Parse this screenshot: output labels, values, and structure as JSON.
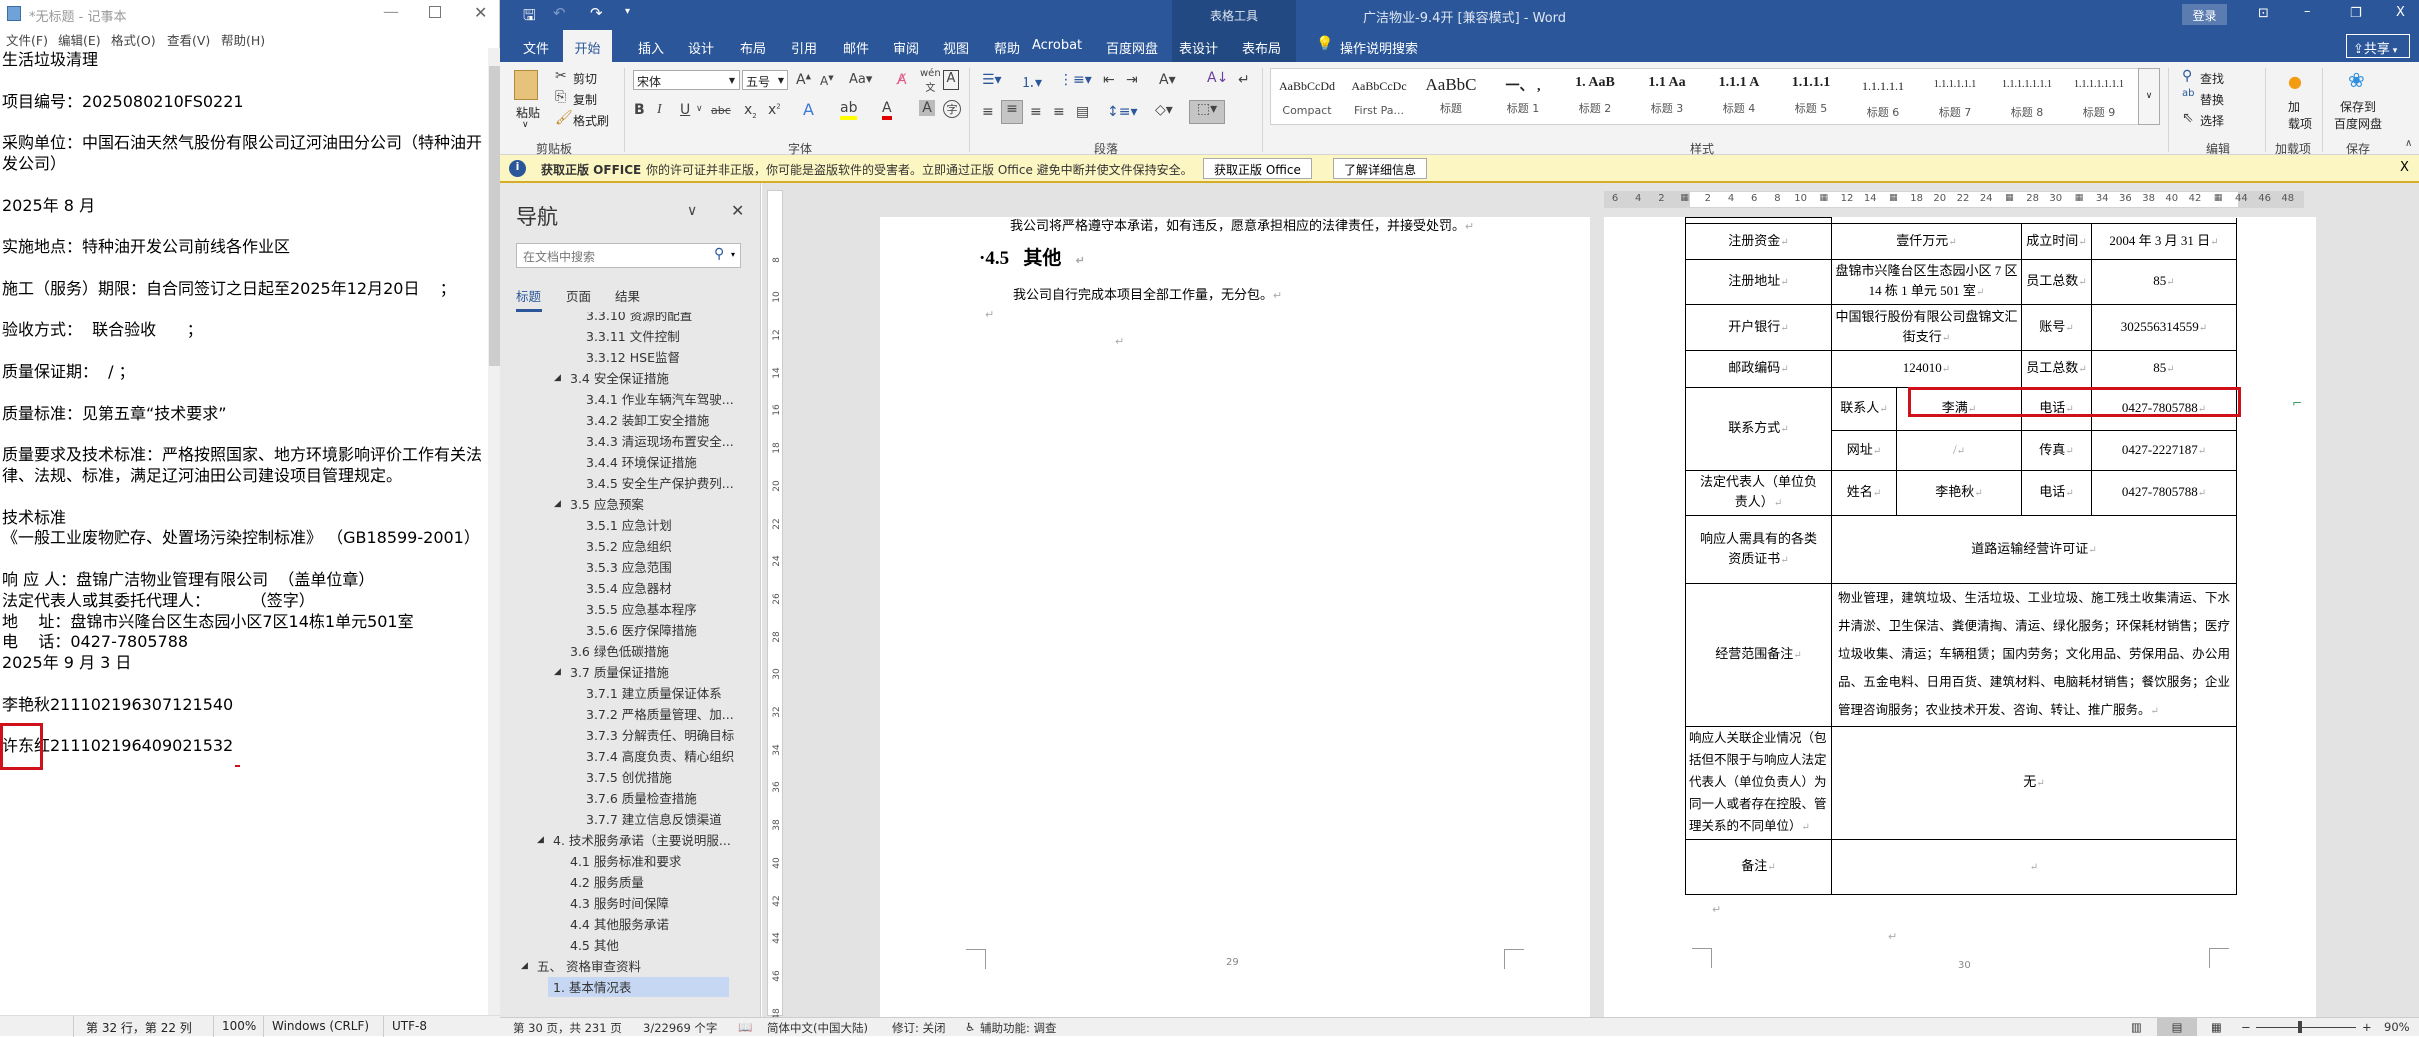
{
  "notepad": {
    "title": "*无标题 - 记事本",
    "menu": [
      "文件(F)",
      "编辑(E)",
      "格式(O)",
      "查看(V)",
      "帮助(H)"
    ],
    "text": "生活垃圾清理\n\n项目编号：2025080210FS0221\n\n采购单位：中国石油天然气股份有限公司辽河油田分公司（特种油开发公司）\n\n2025年 8 月\n\n实施地点：特种油开发公司前线各作业区\n\n施工（服务）期限：自合同签订之日起至2025年12月20日    ；\n\n验收方式：  联合验收      ；\n\n质量保证期：  / ；\n\n质量标准：见第五章“技术要求”\n\n质量要求及技术标准：严格按照国家、地方环境影响评价工作有关法律、法规、标准，满足辽河油田公司建设项目管理规定。\n\n技术标准\n《一般工业废物贮存、处置场污染控制标准》 （GB18599-2001）\n\n响 应 人：盘锦广洁物业管理有限公司  （盖单位章）\n法定代表人或其委托代理人：        （签字）\n地    址：盘锦市兴隆台区生态园小区7区14栋1单元501室\n电    话：0427-7805788\n2025年 9 月 3 日\n\n李艳秋211102196307121540\n\n许东红211102196409021532",
    "status": {
      "position": "第 32 行，第 22 列",
      "zoom": "100%",
      "line_ending": "Windows (CRLF)",
      "encoding": "UTF-8"
    }
  },
  "word": {
    "title": "广洁物业-9.4开 [兼容模式]  -  Word",
    "context_tab_group": "表格工具",
    "login": "登录",
    "share": "共享",
    "tabs": [
      "文件",
      "开始",
      "插入",
      "设计",
      "布局",
      "引用",
      "邮件",
      "审阅",
      "视图",
      "帮助",
      "Acrobat",
      "百度网盘",
      "表设计",
      "表布局"
    ],
    "tell_me": "操作说明搜索",
    "ribbon": {
      "clipboard": {
        "paste": "粘贴",
        "cut": "剪切",
        "copy": "复制",
        "format_painter": "格式刷",
        "label": "剪贴板"
      },
      "font": {
        "name": "宋体",
        "size": "五号",
        "label": "字体"
      },
      "paragraph": {
        "label": "段落"
      },
      "styles": {
        "label": "样式",
        "items": [
          {
            "preview": "AaBbCcDd",
            "name": "Compact"
          },
          {
            "preview": "AaBbCcDc",
            "name": "First Pa..."
          },
          {
            "preview": "AaBbC",
            "name": "标题"
          },
          {
            "preview": "一、 ,",
            "name": "标题 1"
          },
          {
            "preview": "1. AaB",
            "name": "标题 2"
          },
          {
            "preview": "1.1  Aa",
            "name": "标题 3"
          },
          {
            "preview": "1.1.1  A",
            "name": "标题 4"
          },
          {
            "preview": "1.1.1.1",
            "name": "标题 5"
          },
          {
            "preview": "1.1.1.1.1",
            "name": "标题 6"
          },
          {
            "preview": "1.1.1.1.1.1",
            "name": "标题 7"
          },
          {
            "preview": "1.1.1.1.1.1.1",
            "name": "标题 8"
          },
          {
            "preview": "1.1.1.1.1.1.1",
            "name": "标题 9"
          }
        ]
      },
      "editing": {
        "find": "查找",
        "replace": "替换",
        "select": "选择",
        "label": "编辑"
      },
      "addins": {
        "button_line1": "加",
        "button_line2": "载项",
        "label": "加载项"
      },
      "save": {
        "button_line1": "保存到",
        "button_line2": "百度网盘",
        "label": "保存"
      }
    },
    "message_bar": {
      "title": "获取正版 OFFICE",
      "text": "你的许可证并非正版，你可能是盗版软件的受害者。立即通过正版 Office 避免中断并使文件保持安全。",
      "btn_get": "获取正版 Office",
      "btn_learn": "了解详细信息"
    },
    "nav": {
      "title": "导航",
      "search_placeholder": "在文档中搜索",
      "tabs": [
        "标题",
        "页面",
        "结果"
      ],
      "items": [
        {
          "label": "3.3.10 资源的配置",
          "level": 3
        },
        {
          "label": "3.3.11 文件控制",
          "level": 3
        },
        {
          "label": "3.3.12 HSE监督",
          "level": 3
        },
        {
          "label": "3.4 安全保证措施",
          "level": 2,
          "expanded": true
        },
        {
          "label": "3.4.1 作业车辆汽车驾驶...",
          "level": 3
        },
        {
          "label": "3.4.2 装卸工安全措施",
          "level": 3
        },
        {
          "label": "3.4.3 清运现场布置安全...",
          "level": 3
        },
        {
          "label": "3.4.4 环境保证措施",
          "level": 3
        },
        {
          "label": "3.4.5 安全生产保护费列...",
          "level": 3
        },
        {
          "label": "3.5 应急预案",
          "level": 2,
          "expanded": true
        },
        {
          "label": "3.5.1 应急计划",
          "level": 3
        },
        {
          "label": "3.5.2 应急组织",
          "level": 3
        },
        {
          "label": "3.5.3 应急范围",
          "level": 3
        },
        {
          "label": "3.5.4 应急器材",
          "level": 3
        },
        {
          "label": "3.5.5 应急基本程序",
          "level": 3
        },
        {
          "label": "3.5.6 医疗保障措施",
          "level": 3
        },
        {
          "label": "3.6 绿色低碳措施",
          "level": 2
        },
        {
          "label": "3.7 质量保证措施",
          "level": 2,
          "expanded": true
        },
        {
          "label": "3.7.1 建立质量保证体系",
          "level": 3
        },
        {
          "label": "3.7.2 严格质量管理、加...",
          "level": 3
        },
        {
          "label": "3.7.3 分解责任、明确目标",
          "level": 3
        },
        {
          "label": "3.7.4 高度负责、精心组织",
          "level": 3
        },
        {
          "label": "3.7.5 创优措施",
          "level": 3
        },
        {
          "label": "3.7.6 质量检查措施",
          "level": 3
        },
        {
          "label": "3.7.7 建立信息反馈渠道",
          "level": 3
        },
        {
          "label": "4. 技术服务承诺（主要说明服...",
          "level": 1,
          "expanded": true
        },
        {
          "label": "4.1 服务标准和要求",
          "level": 2
        },
        {
          "label": "4.2 服务质量",
          "level": 2
        },
        {
          "label": "4.3 服务时间保障",
          "level": 2
        },
        {
          "label": "4.4 其他服务承诺",
          "level": 2
        },
        {
          "label": "4.5 其他",
          "level": 2
        },
        {
          "label": "五、 资格审查资料",
          "level": 0,
          "expanded": true
        },
        {
          "label": "1. 基本情况表",
          "level": 1,
          "selected": true
        }
      ]
    },
    "hruler_labels": [
      "6",
      "4",
      "2",
      "",
      "2",
      "4",
      "6",
      "8",
      "10",
      "",
      "12",
      "14",
      "",
      "18",
      "20",
      "22",
      "24",
      "",
      "28",
      "30",
      "",
      "34",
      "36",
      "38",
      "40",
      "42",
      "",
      "44",
      "46",
      "48"
    ],
    "vruler_labels": [
      "8",
      "10",
      "12",
      "14",
      "16",
      "18",
      "20",
      "22",
      "24",
      "26",
      "28",
      "30",
      "32",
      "34",
      "36",
      "38",
      "40",
      "42",
      "44",
      "46",
      "48"
    ],
    "page1": {
      "line1": "我公司将严格遵守本承诺，如有违反，愿意承担相应的法律责任，并接受处罚。",
      "heading_num": "4.5",
      "heading_text": "其他",
      "line2": "我公司自行完成本项目全部工作量，无分包。",
      "page_number": "29"
    },
    "page2": {
      "table": {
        "reg_capital_label": "注册资金",
        "reg_capital": "壹仟万元",
        "founded_label": "成立时间",
        "founded": "2004 年 3 月 31 日",
        "reg_address_label": "注册地址",
        "reg_address": "盘锦市兴隆台区生态园小区 7 区 14 栋 1 单元 501 室",
        "employees_label": "员工总数",
        "employees": "85",
        "bank_label": "开户银行",
        "bank": "中国银行股份有限公司盘锦文汇街支行",
        "account_label": "账号",
        "account": "302556314559",
        "postcode_label": "邮政编码",
        "postcode": "124010",
        "employees_label2": "员工总数",
        "employees2": "85",
        "contact_label": "联系方式",
        "contact_person_label": "联系人",
        "contact_person": "李满",
        "phone_label": "电话",
        "phone": "0427-7805788",
        "website_label": "网址",
        "website": "/",
        "fax_label": "传真",
        "fax": "0427-2227187",
        "legal_rep_label": "法定代表人（单位负责人）",
        "name_label": "姓名",
        "legal_rep_name": "李艳秋",
        "legal_phone_label": "电话",
        "legal_phone": "0427-7805788",
        "cert_label": "响应人需具有的各类资质证书",
        "cert": "道路运输经营许可证",
        "scope_label": "经营范围备注",
        "scope": "物业管理，建筑垃圾、生活垃圾、工业垃圾、施工残土收集清运、下水井清淤、卫生保洁、粪便清掏、清运、绿化服务；环保耗材销售；医疗垃圾收集、清运；车辆租赁；国内劳务；文化用品、劳保用品、办公用品、五金电料、日用百货、建筑材料、电脑耗材销售；餐饮服务；企业管理咨询服务；农业技术开发、咨询、转让、推广服务。",
        "related_label": "响应人关联企业情况（包括但不限于与响应人法定代表人（单位负责人）为同一人或者存在控股、管理关系的不同单位）",
        "related": "无",
        "remarks_label": "备注",
        "remarks": ""
      },
      "page_number": "30"
    },
    "status": {
      "page": "第 30 页，共 231 页",
      "words": "3/22969 个字",
      "language": "简体中文(中国大陆)",
      "track_changes": "修订: 关闭",
      "accessibility": "辅助功能: 调查",
      "zoom": "90%",
      "zoom_percent": 90
    },
    "colors": {
      "brand": "#2b579a",
      "highlight_box": "#d0111b",
      "message_bar": "#fcf6c2"
    }
  }
}
